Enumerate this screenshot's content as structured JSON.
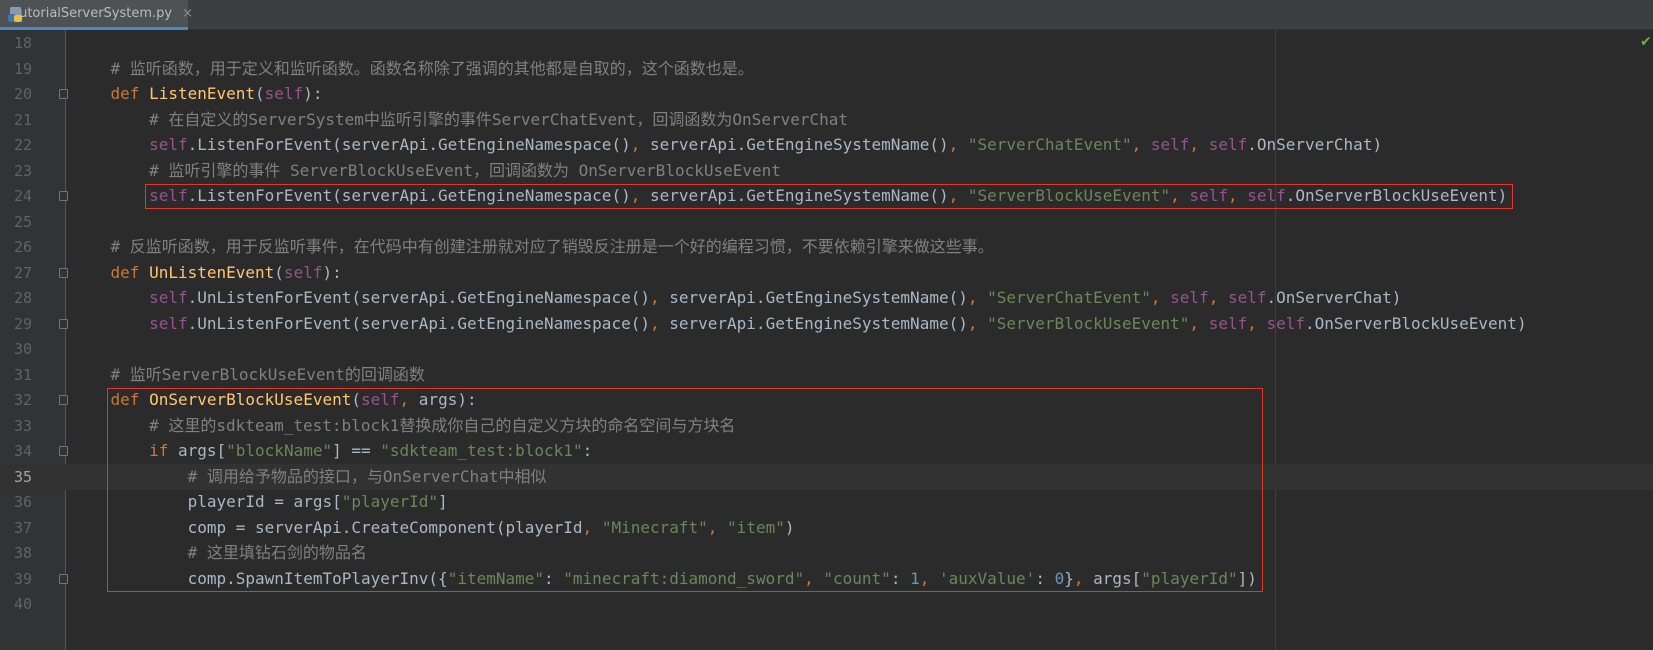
{
  "tab": {
    "filename": "tutorialServerSystem.py",
    "close": "×",
    "icon": "python-file-icon"
  },
  "status": {
    "inspection": "no-problems",
    "icon": "checkmark-icon"
  },
  "current_line": 35,
  "lines": [
    {
      "n": "18",
      "tokens": []
    },
    {
      "n": "19",
      "tokens": [
        {
          "t": "    "
        },
        {
          "t": "# 监听函数，用于定义和监听函数。函数名称除了强调的其他都是自取的，这个函数也是。",
          "c": "cm"
        }
      ]
    },
    {
      "n": "20",
      "tokens": [
        {
          "t": "    "
        },
        {
          "t": "def ",
          "c": "kw"
        },
        {
          "t": "ListenEvent",
          "c": "fn"
        },
        {
          "t": "("
        },
        {
          "t": "self",
          "c": "sf"
        },
        {
          "t": "):"
        }
      ]
    },
    {
      "n": "21",
      "tokens": [
        {
          "t": "        "
        },
        {
          "t": "# 在自定义的ServerSystem中监听引擎的事件ServerChatEvent，回调函数为OnServerChat",
          "c": "cm"
        }
      ]
    },
    {
      "n": "22",
      "tokens": [
        {
          "t": "        "
        },
        {
          "t": "self",
          "c": "sf"
        },
        {
          "t": ".ListenForEvent(serverApi.GetEngineNamespace()"
        },
        {
          "t": ", ",
          "c": "kw"
        },
        {
          "t": "serverApi.GetEngineSystemName()"
        },
        {
          "t": ", ",
          "c": "kw"
        },
        {
          "t": "\"ServerChatEvent\"",
          "c": "st"
        },
        {
          "t": ", ",
          "c": "kw"
        },
        {
          "t": "self",
          "c": "sf"
        },
        {
          "t": ", ",
          "c": "kw"
        },
        {
          "t": "self",
          "c": "sf"
        },
        {
          "t": ".OnServerChat)"
        }
      ]
    },
    {
      "n": "23",
      "tokens": [
        {
          "t": "        "
        },
        {
          "t": "# 监听引擎的事件 ServerBlockUseEvent，回调函数为 OnServerBlockUseEvent",
          "c": "cm"
        }
      ]
    },
    {
      "n": "24",
      "tokens": [
        {
          "t": "        "
        },
        {
          "t": "self",
          "c": "sf"
        },
        {
          "t": ".ListenForEvent(serverApi.GetEngineNamespace()"
        },
        {
          "t": ", ",
          "c": "kw"
        },
        {
          "t": "serverApi.GetEngineSystemName()"
        },
        {
          "t": ", ",
          "c": "kw"
        },
        {
          "t": "\"ServerBlockUseEvent\"",
          "c": "st"
        },
        {
          "t": ", ",
          "c": "kw"
        },
        {
          "t": "self",
          "c": "sf"
        },
        {
          "t": ", ",
          "c": "kw"
        },
        {
          "t": "self",
          "c": "sf"
        },
        {
          "t": ".OnServerBlockUseEvent)"
        }
      ]
    },
    {
      "n": "25",
      "tokens": []
    },
    {
      "n": "26",
      "tokens": [
        {
          "t": "    "
        },
        {
          "t": "# 反监听函数，用于反监听事件，在代码中有创建注册就对应了销毁反注册是一个好的编程习惯，不要依赖引擎来做这些事。",
          "c": "cm"
        }
      ]
    },
    {
      "n": "27",
      "tokens": [
        {
          "t": "    "
        },
        {
          "t": "def ",
          "c": "kw"
        },
        {
          "t": "UnListenEvent",
          "c": "fn"
        },
        {
          "t": "("
        },
        {
          "t": "self",
          "c": "sf"
        },
        {
          "t": "):"
        }
      ]
    },
    {
      "n": "28",
      "tokens": [
        {
          "t": "        "
        },
        {
          "t": "self",
          "c": "sf"
        },
        {
          "t": ".UnListenForEvent(serverApi.GetEngineNamespace()"
        },
        {
          "t": ", ",
          "c": "kw"
        },
        {
          "t": "serverApi.GetEngineSystemName()"
        },
        {
          "t": ", ",
          "c": "kw"
        },
        {
          "t": "\"ServerChatEvent\"",
          "c": "st"
        },
        {
          "t": ", ",
          "c": "kw"
        },
        {
          "t": "self",
          "c": "sf"
        },
        {
          "t": ", ",
          "c": "kw"
        },
        {
          "t": "self",
          "c": "sf"
        },
        {
          "t": ".OnServerChat)"
        }
      ]
    },
    {
      "n": "29",
      "tokens": [
        {
          "t": "        "
        },
        {
          "t": "self",
          "c": "sf"
        },
        {
          "t": ".UnListenForEvent(serverApi.GetEngineNamespace()"
        },
        {
          "t": ", ",
          "c": "kw"
        },
        {
          "t": "serverApi.GetEngineSystemName()"
        },
        {
          "t": ", ",
          "c": "kw"
        },
        {
          "t": "\"ServerBlockUseEvent\"",
          "c": "st"
        },
        {
          "t": ", ",
          "c": "kw"
        },
        {
          "t": "self",
          "c": "sf"
        },
        {
          "t": ", ",
          "c": "kw"
        },
        {
          "t": "self",
          "c": "sf"
        },
        {
          "t": ".OnServerBlockUseEvent)"
        }
      ]
    },
    {
      "n": "30",
      "tokens": []
    },
    {
      "n": "31",
      "tokens": [
        {
          "t": "    "
        },
        {
          "t": "# 监听ServerBlockUseEvent的回调函数",
          "c": "cm"
        }
      ]
    },
    {
      "n": "32",
      "tokens": [
        {
          "t": "    "
        },
        {
          "t": "def ",
          "c": "kw"
        },
        {
          "t": "OnServerBlockUseEvent",
          "c": "fn"
        },
        {
          "t": "("
        },
        {
          "t": "self",
          "c": "sf"
        },
        {
          "t": ", ",
          "c": "kw"
        },
        {
          "t": "args):"
        }
      ]
    },
    {
      "n": "33",
      "tokens": [
        {
          "t": "        "
        },
        {
          "t": "# 这里的sdkteam_test:block1替换成你自己的自定义方块的命名空间与方块名",
          "c": "cm"
        }
      ]
    },
    {
      "n": "34",
      "tokens": [
        {
          "t": "        "
        },
        {
          "t": "if ",
          "c": "kw"
        },
        {
          "t": "args["
        },
        {
          "t": "\"blockName\"",
          "c": "st"
        },
        {
          "t": "] == "
        },
        {
          "t": "\"sdkteam_test:block1\"",
          "c": "st"
        },
        {
          "t": ":"
        }
      ]
    },
    {
      "n": "35",
      "tokens": [
        {
          "t": "            "
        },
        {
          "t": "# 调用给予物品的接口，与OnServerChat中相似",
          "c": "cm"
        }
      ]
    },
    {
      "n": "36",
      "tokens": [
        {
          "t": "            "
        },
        {
          "t": "playerId = args["
        },
        {
          "t": "\"playerId\"",
          "c": "st"
        },
        {
          "t": "]"
        }
      ]
    },
    {
      "n": "37",
      "tokens": [
        {
          "t": "            "
        },
        {
          "t": "comp = serverApi.CreateComponent(playerId"
        },
        {
          "t": ", ",
          "c": "kw"
        },
        {
          "t": "\"Minecraft\"",
          "c": "st"
        },
        {
          "t": ", ",
          "c": "kw"
        },
        {
          "t": "\"item\"",
          "c": "st"
        },
        {
          "t": ")"
        }
      ]
    },
    {
      "n": "38",
      "tokens": [
        {
          "t": "            "
        },
        {
          "t": "# 这里填钻石剑的物品名",
          "c": "cm"
        }
      ]
    },
    {
      "n": "39",
      "tokens": [
        {
          "t": "            "
        },
        {
          "t": "comp.SpawnItemToPlayerInv({"
        },
        {
          "t": "\"itemName\"",
          "c": "st"
        },
        {
          "t": ": "
        },
        {
          "t": "\"minecraft:diamond_sword\"",
          "c": "st"
        },
        {
          "t": ", ",
          "c": "kw"
        },
        {
          "t": "\"count\"",
          "c": "st"
        },
        {
          "t": ": "
        },
        {
          "t": "1",
          "c": "nm"
        },
        {
          "t": ", ",
          "c": "kw"
        },
        {
          "t": "'auxValue'",
          "c": "st"
        },
        {
          "t": ": "
        },
        {
          "t": "0",
          "c": "nm"
        },
        {
          "t": "}"
        },
        {
          "t": ", ",
          "c": "kw"
        },
        {
          "t": "args["
        },
        {
          "t": "\"playerId\"",
          "c": "st"
        },
        {
          "t": "])"
        }
      ]
    },
    {
      "n": "40",
      "tokens": []
    }
  ],
  "folds": [
    "20",
    "24",
    "27",
    "29",
    "32",
    "34",
    "39"
  ],
  "annotations": [
    {
      "name": "highlight-listen-block-use",
      "from": "24",
      "to": "24"
    },
    {
      "name": "highlight-callback-function",
      "from": "32",
      "to": "39"
    }
  ]
}
